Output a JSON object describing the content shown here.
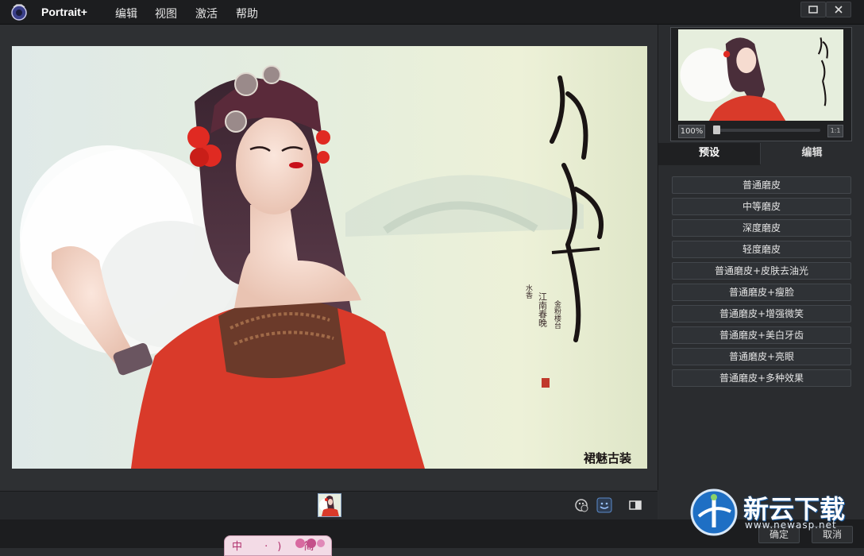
{
  "app": {
    "name": "Portrait+"
  },
  "menu": [
    "编辑",
    "视图",
    "激活",
    "帮助"
  ],
  "navigator": {
    "zoom": "100%",
    "fit_label": "1:1"
  },
  "tabs": [
    "预设",
    "编辑"
  ],
  "presets": [
    "普通磨皮",
    "中等磨皮",
    "深度磨皮",
    "轻度磨皮",
    "普通磨皮+皮肤去油光",
    "普通磨皮+瘦脸",
    "普通磨皮+增强微笑",
    "普通磨皮+美白牙齿",
    "普通磨皮+亮眼",
    "普通磨皮+多种效果"
  ],
  "bottom": {
    "ok": "确定",
    "cancel": "取消"
  },
  "ime": {
    "chars": "中 ·) 简"
  },
  "watermark": {
    "title": "新云下载",
    "url": "www.newasp.net"
  },
  "colors": {
    "accent": "#4a90d9",
    "dress": "#d93a2a",
    "bg": "#2b2d30"
  }
}
